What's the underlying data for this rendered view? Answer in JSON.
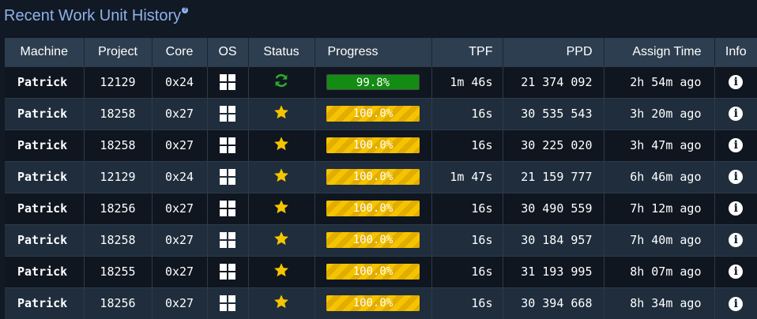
{
  "title": "Recent Work Unit History",
  "columns": {
    "machine": "Machine",
    "project": "Project",
    "core": "Core",
    "os": "OS",
    "status": "Status",
    "progress": "Progress",
    "tpf": "TPF",
    "ppd": "PPD",
    "assign_time": "Assign Time",
    "info": "Info"
  },
  "rows": [
    {
      "machine": "Patrick",
      "project": "12129",
      "core": "0x24",
      "os_icon": "windows-icon",
      "status_icon": "refresh-icon",
      "progress_state": "running",
      "progress_fraction": 0.998,
      "progress_text": "99.8%",
      "tpf": "1m 46s",
      "ppd": "21 374 092",
      "assign_time": "2h 54m ago"
    },
    {
      "machine": "Patrick",
      "project": "18258",
      "core": "0x27",
      "os_icon": "windows-icon",
      "status_icon": "star-icon",
      "progress_state": "done",
      "progress_fraction": 1.0,
      "progress_text": "100.0%",
      "tpf": "16s",
      "ppd": "30 535 543",
      "assign_time": "3h 20m ago"
    },
    {
      "machine": "Patrick",
      "project": "18258",
      "core": "0x27",
      "os_icon": "windows-icon",
      "status_icon": "star-icon",
      "progress_state": "done",
      "progress_fraction": 1.0,
      "progress_text": "100.0%",
      "tpf": "16s",
      "ppd": "30 225 020",
      "assign_time": "3h 47m ago"
    },
    {
      "machine": "Patrick",
      "project": "12129",
      "core": "0x24",
      "os_icon": "windows-icon",
      "status_icon": "star-icon",
      "progress_state": "done",
      "progress_fraction": 1.0,
      "progress_text": "100.0%",
      "tpf": "1m 47s",
      "ppd": "21 159 777",
      "assign_time": "6h 46m ago"
    },
    {
      "machine": "Patrick",
      "project": "18256",
      "core": "0x27",
      "os_icon": "windows-icon",
      "status_icon": "star-icon",
      "progress_state": "done",
      "progress_fraction": 1.0,
      "progress_text": "100.0%",
      "tpf": "16s",
      "ppd": "30 490 559",
      "assign_time": "7h 12m ago"
    },
    {
      "machine": "Patrick",
      "project": "18258",
      "core": "0x27",
      "os_icon": "windows-icon",
      "status_icon": "star-icon",
      "progress_state": "done",
      "progress_fraction": 1.0,
      "progress_text": "100.0%",
      "tpf": "16s",
      "ppd": "30 184 957",
      "assign_time": "7h 40m ago"
    },
    {
      "machine": "Patrick",
      "project": "18255",
      "core": "0x27",
      "os_icon": "windows-icon",
      "status_icon": "star-icon",
      "progress_state": "done",
      "progress_fraction": 1.0,
      "progress_text": "100.0%",
      "tpf": "16s",
      "ppd": "31 193 995",
      "assign_time": "8h 07m ago"
    },
    {
      "machine": "Patrick",
      "project": "18256",
      "core": "0x27",
      "os_icon": "windows-icon",
      "status_icon": "star-icon",
      "progress_state": "done",
      "progress_fraction": 1.0,
      "progress_text": "100.0%",
      "tpf": "16s",
      "ppd": "30 394 668",
      "assign_time": "8h 34m ago"
    }
  ],
  "colors": {
    "title": "#8fb1ea",
    "header_bg": "#2d3e50",
    "row_dark": "#0f1620",
    "row_light": "#1f2d3c",
    "progress_running": "#128c12",
    "progress_done": "#f5c400",
    "star": "#f5c400",
    "refresh": "#2ea82e"
  }
}
